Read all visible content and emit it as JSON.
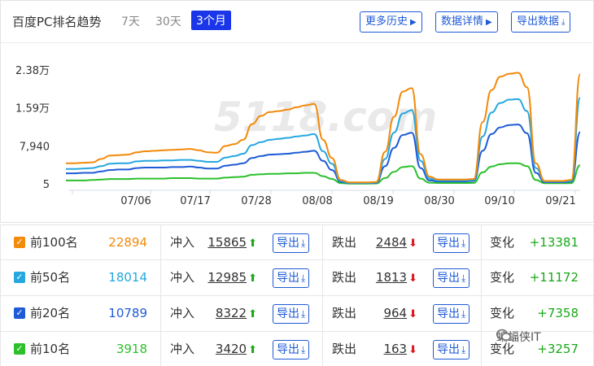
{
  "header": {
    "title": "百度PC排名趋势",
    "ranges": [
      "7天",
      "30天",
      "3个月"
    ],
    "active_range": "3个月",
    "buttons": [
      "更多历史",
      "数据详情",
      "导出数据"
    ]
  },
  "watermark": "5118.com",
  "chart_data": {
    "type": "line",
    "y_ticks": [
      "2.38万",
      "1.59万",
      "7,940",
      "5"
    ],
    "ylim": [
      5,
      23800
    ],
    "x_ticks": [
      "07/06",
      "07/17",
      "07/28",
      "08/08",
      "08/19",
      "08/30",
      "09/10",
      "09/21"
    ],
    "series": [
      {
        "name": "前100名",
        "color": "#f28a0a",
        "values": [
          4300,
          4300,
          4400,
          4500,
          5200,
          5900,
          6000,
          6100,
          6600,
          6800,
          6900,
          7000,
          7100,
          7200,
          7300,
          7000,
          6600,
          6500,
          7900,
          8300,
          9200,
          12500,
          14200,
          15000,
          15200,
          15500,
          16000,
          16400,
          16700,
          9200,
          5400,
          800,
          300,
          300,
          300,
          400,
          6700,
          14000,
          19300,
          20000,
          6200,
          1500,
          900,
          900,
          900,
          900,
          1000,
          12900,
          19600,
          22400,
          23000,
          23200,
          20200,
          4300,
          600,
          600,
          600,
          800,
          22900
        ]
      },
      {
        "name": "前50名",
        "color": "#26a7e0",
        "values": [
          3100,
          3100,
          3200,
          3300,
          3700,
          4200,
          4300,
          4300,
          4700,
          4800,
          4800,
          4900,
          4900,
          5000,
          5000,
          4800,
          4600,
          4600,
          5500,
          5800,
          6300,
          8100,
          8700,
          9200,
          9400,
          9600,
          9900,
          10100,
          10400,
          6800,
          4200,
          600,
          200,
          200,
          200,
          300,
          5200,
          10700,
          14700,
          15400,
          4800,
          1100,
          700,
          700,
          700,
          700,
          800,
          9900,
          14900,
          16900,
          17600,
          17700,
          15200,
          3300,
          500,
          500,
          500,
          600,
          18000
        ]
      },
      {
        "name": "前20名",
        "color": "#1f5bd6",
        "values": [
          2200,
          2200,
          2300,
          2300,
          2600,
          2900,
          3000,
          3000,
          3300,
          3400,
          3400,
          3400,
          3500,
          3500,
          3600,
          3400,
          3200,
          3200,
          3800,
          4000,
          4300,
          5400,
          5800,
          6100,
          6200,
          6300,
          6500,
          6700,
          6900,
          4800,
          2900,
          400,
          150,
          150,
          150,
          200,
          3700,
          7500,
          10200,
          10700,
          3300,
          700,
          500,
          500,
          500,
          500,
          600,
          6900,
          10400,
          11800,
          12300,
          12400,
          10600,
          2300,
          350,
          350,
          350,
          450,
          10800
        ]
      },
      {
        "name": "前10名",
        "color": "#2cc02c",
        "values": [
          700,
          700,
          700,
          800,
          900,
          1000,
          1000,
          1000,
          1100,
          1100,
          1100,
          1100,
          1200,
          1200,
          1200,
          1100,
          1100,
          1100,
          1300,
          1400,
          1500,
          1900,
          2000,
          2100,
          2100,
          2200,
          2200,
          2300,
          2300,
          1600,
          1000,
          150,
          60,
          60,
          60,
          80,
          1200,
          2500,
          3500,
          3700,
          1100,
          250,
          180,
          180,
          180,
          180,
          200,
          2400,
          3600,
          4100,
          4300,
          4300,
          3700,
          800,
          120,
          120,
          120,
          160,
          3900
        ]
      }
    ]
  },
  "rows": [
    {
      "label": "前100名",
      "color": "#f28a0a",
      "total": "22894",
      "in_label": "冲入",
      "in_value": "15865",
      "export": "导出",
      "out_label": "跌出",
      "out_value": "2484",
      "change_label": "变化",
      "change": "+13381"
    },
    {
      "label": "前50名",
      "color": "#26a7e0",
      "total": "18014",
      "in_label": "冲入",
      "in_value": "12985",
      "export": "导出",
      "out_label": "跌出",
      "out_value": "1813",
      "change_label": "变化",
      "change": "+11172"
    },
    {
      "label": "前20名",
      "color": "#1f5bd6",
      "total": "10789",
      "in_label": "冲入",
      "in_value": "8322",
      "export": "导出",
      "out_label": "跌出",
      "out_value": "964",
      "change_label": "变化",
      "change": "+7358"
    },
    {
      "label": "前10名",
      "color": "#2cc02c",
      "total": "3918",
      "in_label": "冲入",
      "in_value": "3420",
      "export": "导出",
      "out_label": "跌出",
      "out_value": "163",
      "change_label": "变化",
      "change": "+3257"
    }
  ],
  "footer_watermark": "蝙蝠侠IT"
}
